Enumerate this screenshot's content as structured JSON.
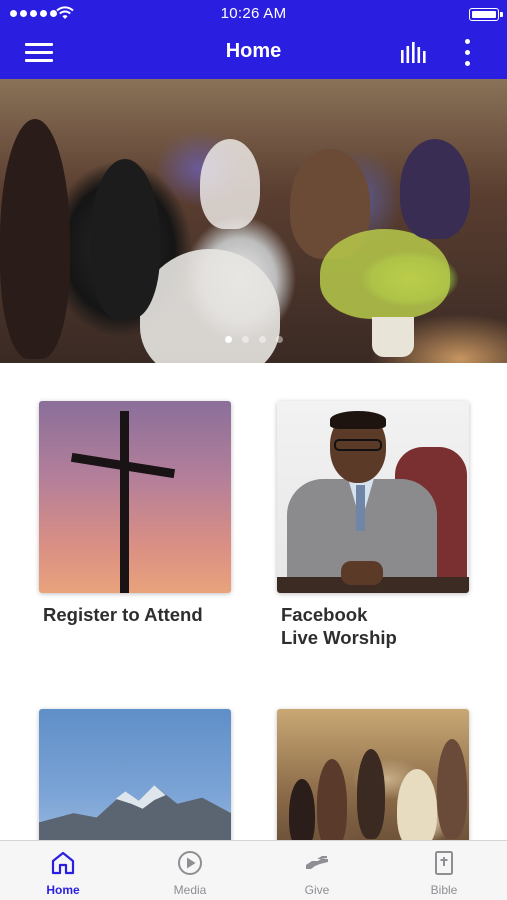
{
  "status_bar": {
    "time": "10:26 AM"
  },
  "nav": {
    "title": "Home"
  },
  "hero": {
    "slide_count": 4,
    "active_slide": 1
  },
  "cards": [
    {
      "title_lines": [
        "Register to Attend"
      ]
    },
    {
      "title_lines": [
        "Facebook",
        "Live Worship"
      ]
    },
    {
      "title_lines": []
    },
    {
      "title_lines": []
    }
  ],
  "tabs": [
    {
      "label": "Home",
      "icon": "house-icon",
      "active": true
    },
    {
      "label": "Media",
      "icon": "play-circle-icon",
      "active": false
    },
    {
      "label": "Give",
      "icon": "hand-icon",
      "active": false
    },
    {
      "label": "Bible",
      "icon": "bible-icon",
      "active": false
    }
  ],
  "colors": {
    "accent": "#2a1fe0",
    "inactive": "#8e8e93",
    "card_text": "#2e2e2e"
  }
}
